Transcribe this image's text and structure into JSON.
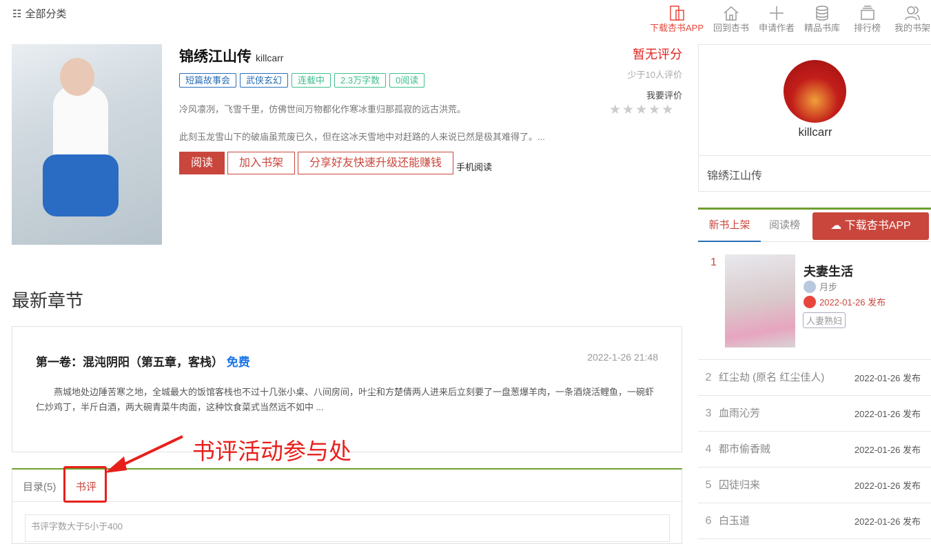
{
  "topbar": {
    "categories_label": "全部分类",
    "nav": [
      {
        "label": "下载杏书APP",
        "icon": "phone-app-icon"
      },
      {
        "label": "回到杏书",
        "icon": "home-icon"
      },
      {
        "label": "申请作者",
        "icon": "plus-icon"
      },
      {
        "label": "精品书库",
        "icon": "database-icon"
      },
      {
        "label": "排行榜",
        "icon": "ranking-icon"
      },
      {
        "label": "我的书架",
        "icon": "user-icon"
      }
    ]
  },
  "book": {
    "title": "锦绣江山传",
    "author": "killcarr",
    "tags": [
      "短篇故事会",
      "武侠玄幻",
      "连载中",
      "2.3万字数",
      "0阅读"
    ],
    "desc1": "冷风凛冽，飞雪千里，仿佛世间万物都化作寒冰重归那孤寂的远古洪荒。",
    "desc2": "此刻玉龙雪山下的破庙虽荒废已久，但在这冰天雪地中对赶路的人来说已然是极其难得了。...",
    "read": "阅读",
    "shelf": "加入书架",
    "share": "分享好友快速升级还能赚钱",
    "mobile": "手机阅读",
    "rating": "暂无评分",
    "rating_note": "少于10人评价",
    "rate_label": "我要评价",
    "stars": 0
  },
  "latest": {
    "heading": "最新章节",
    "chapter": "第一卷：混沌阴阳（第五章，客栈）",
    "free": "免费",
    "time": "2022-1-26 21:48",
    "excerpt": "燕城地处边陲苦寒之地，全城最大的饭馆客栈也不过十几张小桌、八间房间，叶尘和方楚倩两人进来后立刻要了一盘葱爆羊肉，一条酒烧活鲤鱼，一碗虾仁炒鸡丁，半斤白酒，两大碗青菜牛肉面，这种饮食菜式当然远不如中 ..."
  },
  "annotation": "书评活动参与处",
  "tabs": {
    "toc": "目录(5)",
    "review": "书评",
    "review_placeholder": "书评字数大于5小于400"
  },
  "sidebar": {
    "author": "killcarr",
    "book": "锦绣江山传",
    "tab_new": "新书上架",
    "tab_rank": "阅读榜",
    "download": "下载杏书APP",
    "top": {
      "rank": "1",
      "title": "夫妻生活",
      "author": "月步",
      "date": "2022-01-26 发布",
      "tag": "人妻熟妇"
    },
    "items": [
      {
        "rank": "2",
        "title": "红尘劫 (原名 红尘佳人)",
        "date": "2022-01-26 发布"
      },
      {
        "rank": "3",
        "title": "血雨沁芳",
        "date": "2022-01-26 发布"
      },
      {
        "rank": "4",
        "title": "都市偷香贼",
        "date": "2022-01-26 发布"
      },
      {
        "rank": "5",
        "title": "囚徒归来",
        "date": "2022-01-26 发布"
      },
      {
        "rank": "6",
        "title": "白玉道",
        "date": "2022-01-26 发布"
      }
    ]
  }
}
